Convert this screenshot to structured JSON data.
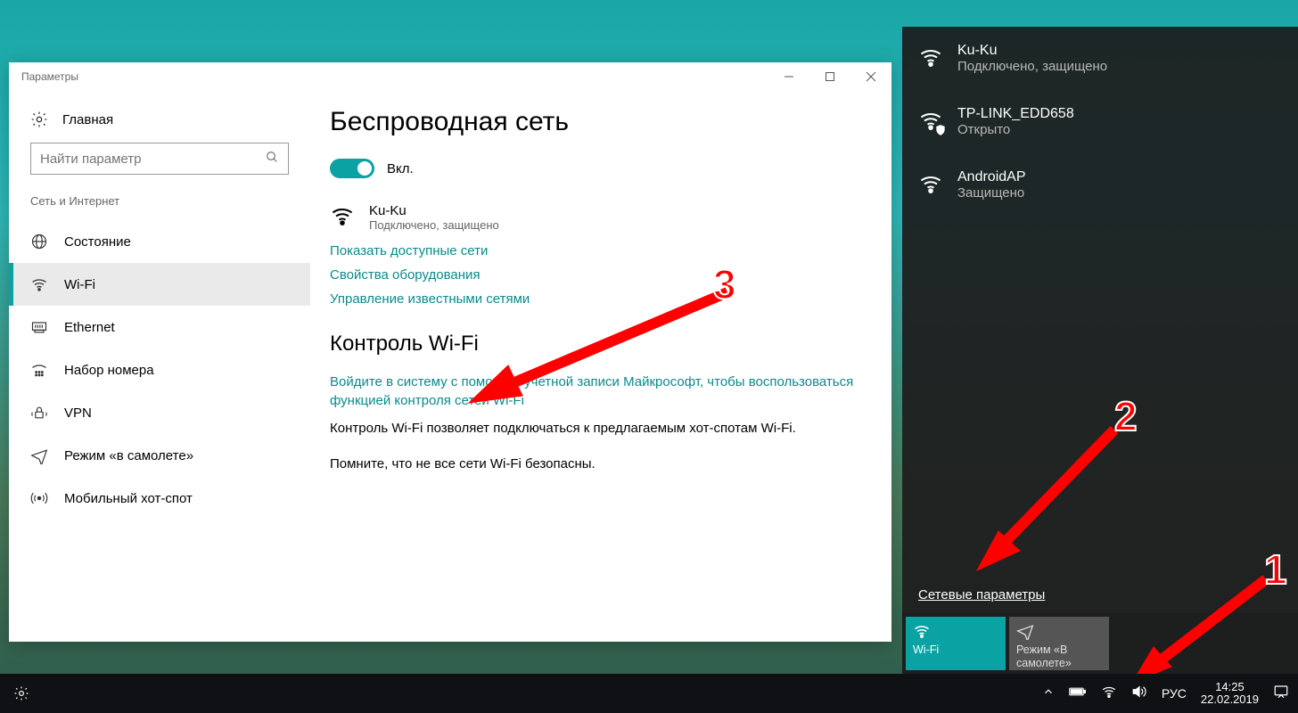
{
  "settings": {
    "window_title": "Параметры",
    "home_label": "Главная",
    "search_placeholder": "Найти параметр",
    "section_label": "Сеть и Интернет",
    "nav": [
      {
        "label": "Состояние"
      },
      {
        "label": "Wi-Fi"
      },
      {
        "label": "Ethernet"
      },
      {
        "label": "Набор номера"
      },
      {
        "label": "VPN"
      },
      {
        "label": "Режим «в самолете»"
      },
      {
        "label": "Мобильный хот-спот"
      }
    ],
    "content": {
      "heading": "Беспроводная сеть",
      "toggle_label": "Вкл.",
      "wifi_name": "Ku-Ku",
      "wifi_status": "Подключено, защищено",
      "link_show": "Показать доступные сети",
      "link_hw": "Свойства оборудования",
      "link_manage": "Управление известными сетями",
      "sub_heading": "Контроль Wi-Fi",
      "ms_link": "Войдите в систему с помощью учетной записи Майкрософт, чтобы воспользоваться функцией контроля сетей Wi-Fi",
      "para1": "Контроль Wi-Fi позволяет подключаться к предлагаемым хот-спотам Wi-Fi.",
      "para2": "Помните, что не все сети Wi-Fi безопасны."
    }
  },
  "flyout": {
    "networks": [
      {
        "name": "Ku-Ku",
        "sub": "Подключено, защищено"
      },
      {
        "name": "TP-LINK_EDD658",
        "sub": "Открыто"
      },
      {
        "name": "AndroidAP",
        "sub": "Защищено"
      }
    ],
    "link": "Сетевые параметры",
    "tile_wifi": "Wi-Fi",
    "tile_airplane": "Режим «В самолете»"
  },
  "taskbar": {
    "lang": "РУС",
    "time": "14:25",
    "date": "22.02.2019"
  },
  "annotations": {
    "n1": "1",
    "n2": "2",
    "n3": "3"
  }
}
